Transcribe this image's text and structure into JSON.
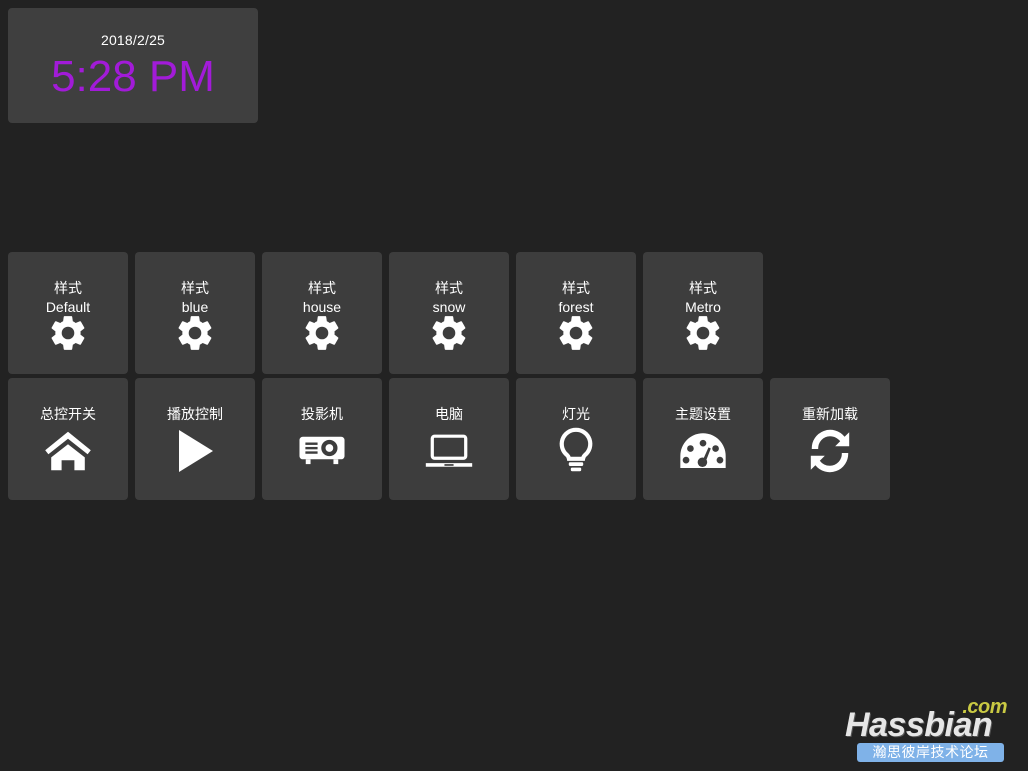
{
  "colors": {
    "page_background": "#222222",
    "tile_background": "#3d3d3d",
    "clock_background": "#3f3f3f",
    "clock_time_accent": "#a21bd8",
    "text": "#ffffff",
    "watermark_com": "#c9c943",
    "watermark_bar": "#7fb2e8"
  },
  "clock": {
    "date": "2018/2/25",
    "time": "5:28 PM"
  },
  "style_row": {
    "tiles": [
      {
        "title": "样式",
        "subtitle": "Default",
        "icon": "gear-icon"
      },
      {
        "title": "样式",
        "subtitle": "blue",
        "icon": "gear-icon"
      },
      {
        "title": "样式",
        "subtitle": "house",
        "icon": "gear-icon"
      },
      {
        "title": "样式",
        "subtitle": "snow",
        "icon": "gear-icon"
      },
      {
        "title": "样式",
        "subtitle": "forest",
        "icon": "gear-icon"
      },
      {
        "title": "样式",
        "subtitle": "Metro",
        "icon": "gear-icon"
      }
    ]
  },
  "action_row": {
    "tiles": [
      {
        "title": "总控开关",
        "icon": "home-icon"
      },
      {
        "title": "播放控制",
        "icon": "play-icon"
      },
      {
        "title": "投影机",
        "icon": "projector-icon"
      },
      {
        "title": "电脑",
        "icon": "laptop-icon"
      },
      {
        "title": "灯光",
        "icon": "lightbulb-icon"
      },
      {
        "title": "主题设置",
        "icon": "gauge-icon"
      },
      {
        "title": "重新加载",
        "icon": "refresh-icon"
      }
    ]
  },
  "watermark": {
    "com": ".com",
    "name": "Hassbian",
    "forum": "瀚思彼岸技术论坛"
  }
}
